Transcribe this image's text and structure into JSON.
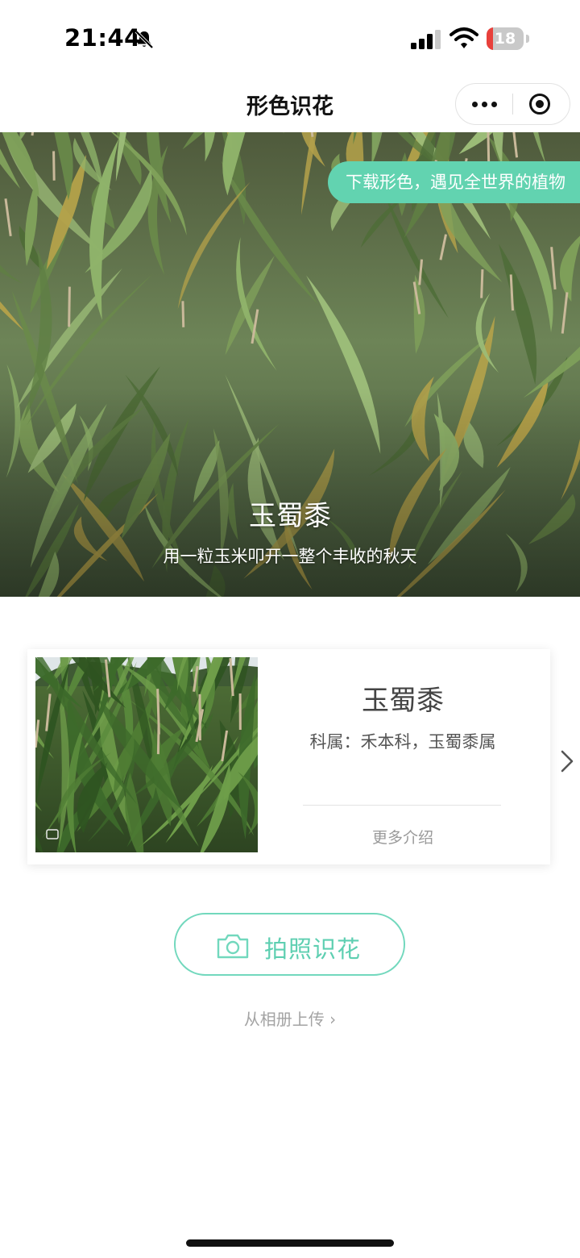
{
  "status_bar": {
    "time": "21:44",
    "battery_level": "18",
    "battery_fraction": 0.18,
    "icons": [
      "bell-muted-icon",
      "signal-icon",
      "wifi-icon",
      "battery-icon"
    ]
  },
  "nav": {
    "title": "形色识花",
    "more_icon": "ellipsis-icon",
    "close_icon": "target-circle-icon"
  },
  "hero": {
    "banner": "下载形色，遇见全世界的植物",
    "plant_name": "玉蜀黍",
    "tagline": "用一粒玉米叩开一整个丰收的秋天"
  },
  "card": {
    "name": "玉蜀黍",
    "family": "科属：禾本科，玉蜀黍属",
    "more_link": "更多介绍",
    "next_icon": "chevron-right-icon"
  },
  "camera_button": {
    "label": "拍照识花",
    "icon": "camera-icon"
  },
  "album_link": "从相册上传 ›",
  "colors": {
    "accent": "#5ecfb1",
    "banner_bg": "#62d3b0",
    "battery_low": "#e8403b"
  }
}
